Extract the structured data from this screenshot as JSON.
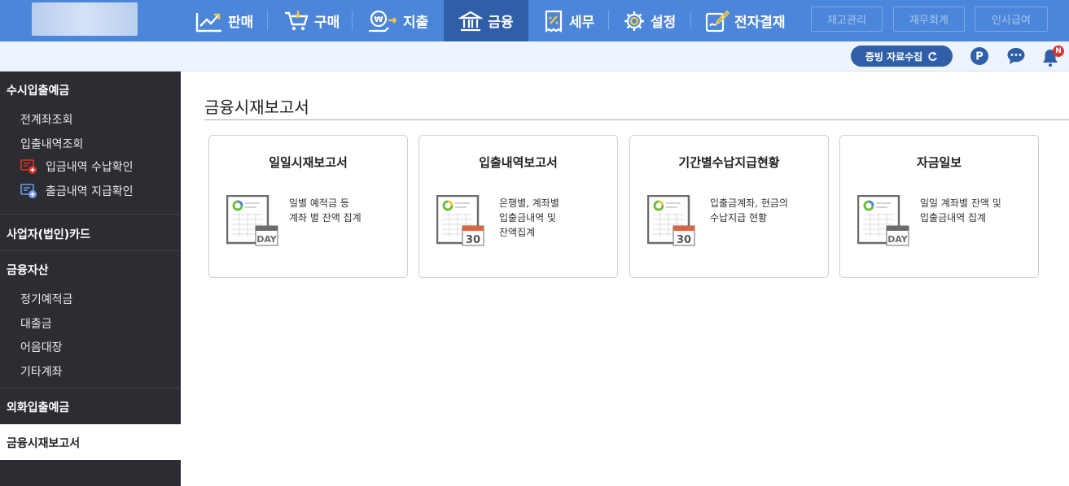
{
  "nav": {
    "items": [
      {
        "label": "판매",
        "icon": "chart-up-icon"
      },
      {
        "label": "구매",
        "icon": "cart-icon"
      },
      {
        "label": "지출",
        "icon": "coin-hand-icon"
      },
      {
        "label": "금융",
        "icon": "bank-icon",
        "active": true
      },
      {
        "label": "세무",
        "icon": "tax-receipt-icon"
      },
      {
        "label": "설정",
        "icon": "gear-icon"
      },
      {
        "label": "전자결재",
        "icon": "sign-pen-icon"
      }
    ],
    "buttons": [
      "재고관리",
      "재무회계",
      "인사급여"
    ]
  },
  "utilbar": {
    "collect_label": "증빙 자료수집",
    "point_icon": "P",
    "badge": "N"
  },
  "sidebar": {
    "sections": [
      {
        "label": "수시입출예금",
        "items": [
          "전계좌조회",
          "입출내역조회",
          "입금내역 수납확인",
          "출금내역 지급확인"
        ]
      },
      {
        "label": "사업자(법인)카드"
      },
      {
        "label": "금융자산",
        "items": [
          "정기예적금",
          "대출금",
          "어음대장",
          "기타계좌"
        ]
      },
      {
        "label": "외화입출예금"
      },
      {
        "label": "금융시재보고서",
        "active": true
      }
    ]
  },
  "main": {
    "title": "금융시재보고서",
    "cards": [
      {
        "title": "일일시재보고서",
        "desc": "일별 예적금 등\n계좌 별 잔액 집계",
        "icon_label": "DAY"
      },
      {
        "title": "입출내역보고서",
        "desc": "은행별, 계좌별\n입출금내역 및\n잔액집계",
        "icon_label": "30"
      },
      {
        "title": "기간별수납지급현황",
        "desc": "입출금계좌, 현금의\n수납지급 현황",
        "icon_label": "30"
      },
      {
        "title": "자금일보",
        "desc": "일일 계좌별 잔액 및\n입출금내역 집계",
        "icon_label": "DAY"
      }
    ]
  },
  "colors": {
    "nav_bg": "#4c86da",
    "nav_active": "#2f5fa8",
    "sidebar_bg": "#2c2c33",
    "accent_red": "#e0302b"
  }
}
